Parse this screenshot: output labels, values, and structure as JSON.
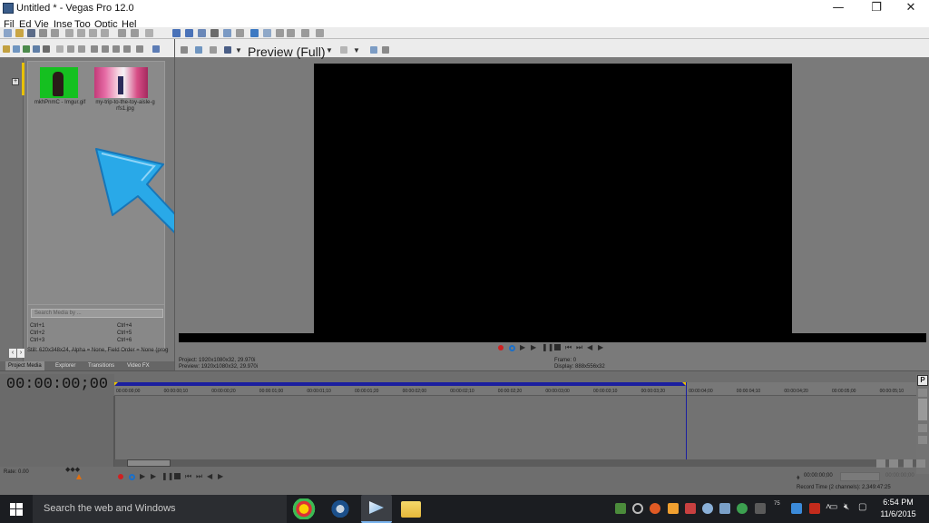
{
  "window": {
    "title": "Untitled * - Vegas Pro 12.0",
    "minimize_glyph": "—",
    "restore_glyph": "❐",
    "close_glyph": "✕"
  },
  "menu": [
    "Fil",
    "Ed",
    "Vie",
    "Inse",
    "Too",
    "Optic",
    "Hel"
  ],
  "project_media": {
    "items": [
      {
        "label": "mkhPnmC - Imgur.gif",
        "icon": "green-screen-person-thumbnail"
      },
      {
        "label": "my-trip-to-the-toy-aisle-g rfs1.jpg",
        "icon": "toy-aisle-photo-thumbnail"
      }
    ],
    "search_placeholder": "Search Media by ...",
    "shortcuts": [
      "Ctrl+1",
      "Ctrl+2",
      "Ctrl+3",
      "Ctrl+4",
      "Ctrl+5",
      "Ctrl+6"
    ],
    "status": "Still: 620x348x24, Alpha = None, Field Order = None (prog",
    "tabs": [
      "Project Media",
      "Explorer",
      "Transitions",
      "Video FX"
    ]
  },
  "preview": {
    "title": "Preview (Full)",
    "project_label": "Project:",
    "project_value": "1920x1080x32, 29.970i",
    "preview_label": "Preview:",
    "preview_value": "1920x1080x32, 29.970i",
    "frame_label": "Frame:",
    "frame_value": "0",
    "display_label": "Display:",
    "display_value": "888x556x32"
  },
  "timeline": {
    "timecode": "00:00:00;00",
    "ruler_labels": [
      "00:00:00;00",
      "00:00:00;10",
      "00:00:00;20",
      "00:00:01;00",
      "00:00:01;10",
      "00:00:01;20",
      "00:00:02;00",
      "00:00:02;10",
      "00:00:02;20",
      "00:00:03;00",
      "00:00:03;10",
      "00:00:03;20",
      "00:00:04;00",
      "00:00:04;10",
      "00:00:04;20",
      "00:00:05;00",
      "00:00:05;10"
    ],
    "rate_label": "Rate: 0.00",
    "p_button": "P",
    "position_readout": "00:00:00;00",
    "end_readout": "00:00:00;00",
    "record_time": "Record Time (2 channels): 2,349:47:25"
  },
  "taskbar": {
    "search_text": "Search the web and Windows",
    "time": "6:54 PM",
    "date": "11/6/2015",
    "tray_temp": "75"
  },
  "colors": {
    "arrow": "#29a9e8",
    "loop_bar": "#1b1fa0",
    "accent_yellow": "#e8c100"
  }
}
